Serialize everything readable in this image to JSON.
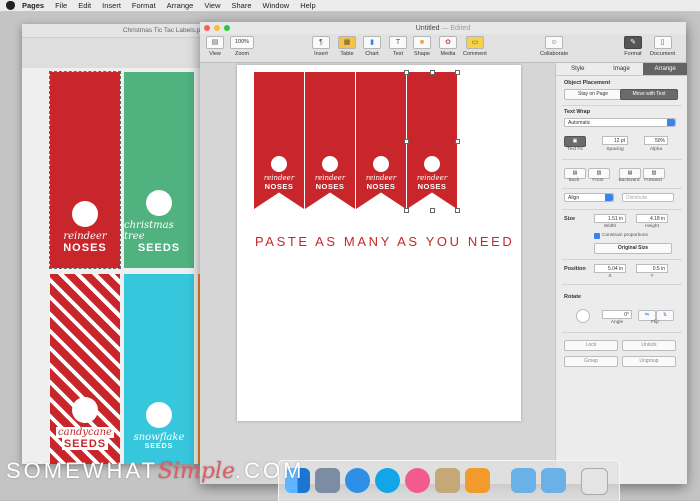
{
  "menubar": {
    "app": "Pages",
    "items": [
      "File",
      "Edit",
      "Insert",
      "Format",
      "Arrange",
      "View",
      "Share",
      "Window",
      "Help"
    ]
  },
  "back_window": {
    "title": "Christmas Tic Tac Labels.pd",
    "tags": [
      {
        "line1": "reindeer",
        "line2": "NOSES"
      },
      {
        "line1": "christmas tree",
        "line2": "SEEDS"
      },
      {
        "line1": "candycane",
        "line2": "SEEDS"
      },
      {
        "line1": "snowflake",
        "line2": "SEEDS"
      }
    ]
  },
  "main_window": {
    "title": "Untitled",
    "edited": "— Edited",
    "toolbar": {
      "view": "View",
      "zoom": "Zoom",
      "zoom_value": "100%",
      "insert": "Insert",
      "table": "Table",
      "chart": "Chart",
      "text": "Text",
      "shape": "Shape",
      "media": "Media",
      "comment": "Comment",
      "collaborate": "Collaborate",
      "format": "Format",
      "document": "Document"
    },
    "banners": [
      {
        "line1": "reindeer",
        "line2": "NOSES"
      },
      {
        "line1": "reindeer",
        "line2": "NOSES"
      },
      {
        "line1": "reindeer",
        "line2": "NOSES"
      },
      {
        "line1": "reindeer",
        "line2": "NOSES"
      }
    ],
    "caption": "PASTE AS MANY AS YOU NEED"
  },
  "inspector": {
    "tabs": [
      "Style",
      "Image",
      "Arrange"
    ],
    "object_placement": "Object Placement",
    "stay_on_page": "Stay on Page",
    "move_with_text": "Move with Text",
    "text_wrap": "Text Wrap",
    "text_wrap_value": "Automatic",
    "text_fit": "Text Fit",
    "spacing": "Spacing",
    "spacing_value": "12 pt",
    "alpha": "Alpha",
    "alpha_value": "50%",
    "back": "Back",
    "front": "Front",
    "backward": "Backward",
    "forward": "Forward",
    "align": "Align",
    "distribute": "Distribute",
    "size": "Size",
    "width": "Width",
    "height": "Height",
    "width_value": "1.51 in",
    "height_value": "4.18 in",
    "constrain": "Constrain proportions",
    "original_size": "Original Size",
    "position": "Position",
    "pos_x": "5.04 in",
    "pos_y": "0.5 in",
    "x_label": "X",
    "y_label": "Y",
    "rotate": "Rotate",
    "angle": "Angle",
    "angle_value": "0°",
    "flip": "Flip",
    "lock": "Lock",
    "unlock": "Unlock",
    "group": "Group",
    "ungroup": "Ungroup"
  },
  "watermark": {
    "part1": "SOMEWHAT",
    "part2": "Simple",
    "part3": ".COM"
  },
  "colors": {
    "red": "#c8262b",
    "green": "#4fb27f",
    "cyan": "#37c7dd",
    "accent": "#3b82f0"
  }
}
